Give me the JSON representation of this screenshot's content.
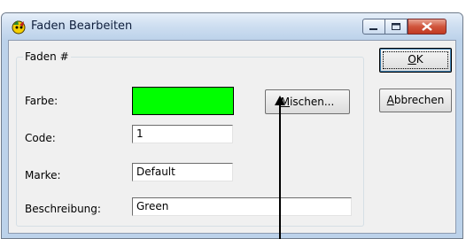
{
  "window": {
    "title": "Faden Bearbeiten",
    "icon": "embroidery-app-icon"
  },
  "titlebar_buttons": [
    "minimize-icon",
    "maximize-icon",
    "close-icon"
  ],
  "group": {
    "label": "Faden #"
  },
  "form": {
    "color_label": "Farbe:",
    "color_value": "#00ff00",
    "mix_button": {
      "mnemonic": "M",
      "rest": "ischen..."
    },
    "code_label": "Code:",
    "code_value": "1",
    "brand_label": "Marke:",
    "brand_value": "Default",
    "description_label": "Beschreibung:",
    "description_value": "Green"
  },
  "buttons": {
    "ok": {
      "mnemonic": "O",
      "rest": "K"
    },
    "cancel": {
      "mnemonic": "A",
      "rest": "bbrechen"
    }
  },
  "colors": {
    "accent_green": "#00ff00",
    "close_red": "#c23a22"
  }
}
